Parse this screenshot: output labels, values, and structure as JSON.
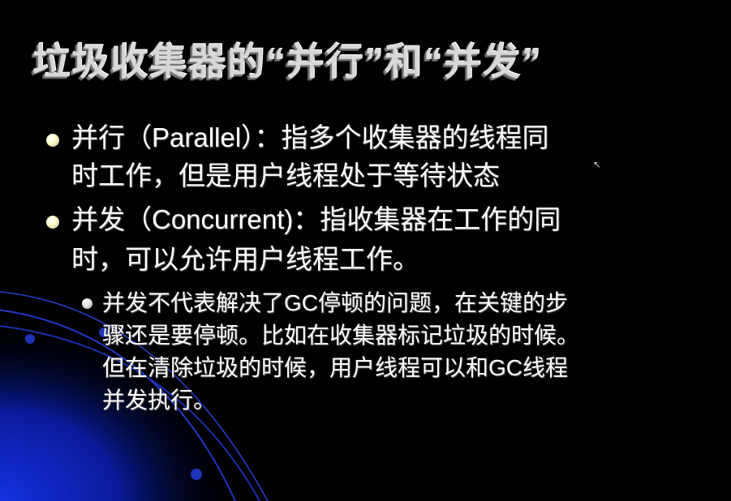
{
  "slide": {
    "title": "垃圾收集器的“并行”和“并发”",
    "bullets": [
      {
        "lines": [
          "并行（Parallel）：指多个收集器的线程同",
          "时工作，但是用户线程处于等待状态"
        ]
      },
      {
        "lines": [
          "并发（Concurrent)：指收集器在工作的同",
          "时，可以允许用户线程工作。"
        ]
      }
    ],
    "sub_bullets": [
      {
        "lines": [
          "并发不代表解决了GC停顿的问题，在关键的步",
          "骤还是要停顿。比如在收集器标记垃圾的时候。",
          "但在清除垃圾的时候，用户线程可以和GC线程",
          "并发执行。"
        ]
      }
    ]
  },
  "colors": {
    "background": "#000000",
    "accent": "#1a2fd0",
    "bullet": "#ffffcc"
  }
}
